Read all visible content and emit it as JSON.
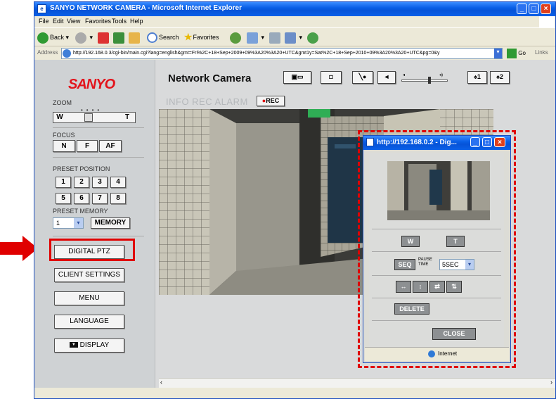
{
  "window": {
    "title": "SANYO NETWORK CAMERA - Microsoft Internet Explorer",
    "menu": [
      "File",
      "Edit",
      "View",
      "Favorites",
      "Tools",
      "Help"
    ],
    "toolbar": {
      "back": "Back",
      "search": "Search",
      "favorites": "Favorites"
    },
    "address_label": "Address",
    "address_url": "http://192.168.0.3/cgi-bin/main.cgi?lang=english&gmt=Fri%2C+18+Sep+2009+09%3A20%3A20+UTC&gmt1y=Sat%2C+18+Sep+2010+09%3A20%3A20+UTC&pg=0&y",
    "go": "Go",
    "links": "Links"
  },
  "page": {
    "logo": "SANYO",
    "header_title": "Network Camera",
    "preset_buttons": [
      "1",
      "2"
    ],
    "status_text": "INFO REC ALARM",
    "rec_label": "REC"
  },
  "left_panel": {
    "zoom_label": "ZOOM",
    "zoom_w": "W",
    "zoom_t": "T",
    "focus_label": "FOCUS",
    "focus_buttons": [
      "N",
      "F",
      "AF"
    ],
    "preset_position_label": "PRESET POSITION",
    "preset_numbers": [
      "1",
      "2",
      "3",
      "4",
      "5",
      "6",
      "7",
      "8"
    ],
    "preset_memory_label": "PRESET MEMORY",
    "memory_select": "1",
    "memory_button": "MEMORY",
    "digital_ptz": "DIGITAL PTZ",
    "client_settings": "CLIENT SETTINGS",
    "menu": "MENU",
    "language": "LANGUAGE",
    "display": "DISPLAY"
  },
  "popup": {
    "title": "http://192.168.0.2 - Dig...",
    "zoom_w": "W",
    "zoom_t": "T",
    "seq": "SEQ",
    "pause_time_label": "PAUSE TIME",
    "pause_time_value": "5SEC",
    "delete": "DELETE",
    "close": "CLOSE",
    "status_zone": "Internet"
  },
  "colors": {
    "highlight": "#e00000",
    "sanyo_red": "#e3131b",
    "xp_blue": "#0a5fe6"
  }
}
